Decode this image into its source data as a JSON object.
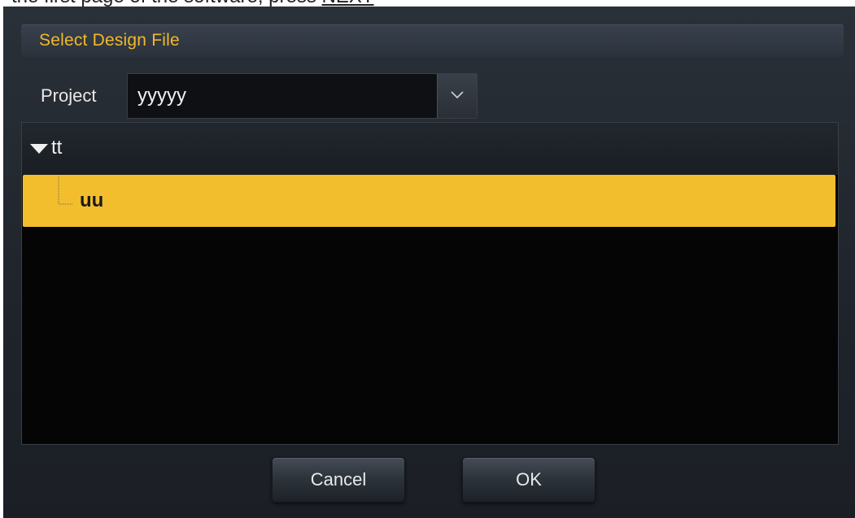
{
  "doc": {
    "text_before": "the first page of the software, press ",
    "link_text": "NEXT"
  },
  "dialog": {
    "title": "Select Design File",
    "project": {
      "label": "Project",
      "selected": "yyyyy"
    },
    "tree": {
      "root": {
        "label": "tt",
        "expanded": true
      },
      "children": [
        {
          "label": "uu",
          "selected": true
        }
      ]
    },
    "buttons": {
      "cancel": "Cancel",
      "ok": "OK"
    },
    "colors": {
      "accent": "#f2be2e",
      "title_text": "#f2b928",
      "background": "#1f242b"
    },
    "icons": {
      "dropdown": "chevron-down-icon",
      "expand": "triangle-down-icon",
      "connector": "tree-connector-icon"
    }
  }
}
